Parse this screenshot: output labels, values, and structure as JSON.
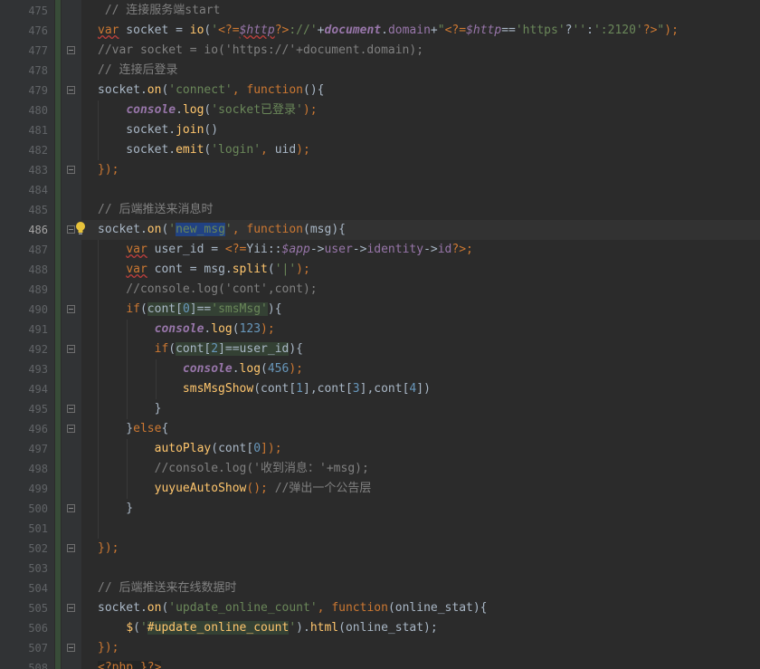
{
  "editor": {
    "current_line": "486",
    "lines": [
      {
        "n": "475",
        "segs": [
          {
            "t": " // 连接服务端start",
            "c": "cm"
          }
        ]
      },
      {
        "n": "476",
        "segs": [
          {
            "t": "var",
            "c": "kw wavy"
          },
          {
            "t": " socket = ",
            "c": ""
          },
          {
            "t": "io",
            "c": "fn"
          },
          {
            "t": "(",
            "c": ""
          },
          {
            "t": "'",
            "c": "str"
          },
          {
            "t": "<?=",
            "c": "php"
          },
          {
            "t": "$http",
            "c": "phpvar wavy"
          },
          {
            "t": "?>",
            "c": "php"
          },
          {
            "t": "://'",
            "c": "str"
          },
          {
            "t": "+",
            "c": ""
          },
          {
            "t": "document",
            "c": "glob"
          },
          {
            "t": ".",
            "c": ""
          },
          {
            "t": "domain",
            "c": "prop"
          },
          {
            "t": "+",
            "c": ""
          },
          {
            "t": "\"",
            "c": "str"
          },
          {
            "t": "<?=",
            "c": "php"
          },
          {
            "t": "$http",
            "c": "phpvar"
          },
          {
            "t": "==",
            "c": ""
          },
          {
            "t": "'https'",
            "c": "str"
          },
          {
            "t": "?",
            "c": ""
          },
          {
            "t": "''",
            "c": "str"
          },
          {
            "t": ":",
            "c": ""
          },
          {
            "t": "':2120'",
            "c": "str"
          },
          {
            "t": "?>",
            "c": "php"
          },
          {
            "t": "\"",
            "c": "str"
          },
          {
            "t": ");",
            "c": "punct"
          }
        ]
      },
      {
        "n": "477",
        "segs": [
          {
            "t": "//var socket = io('https://'+document.domain);",
            "c": "cm"
          }
        ]
      },
      {
        "n": "478",
        "segs": [
          {
            "t": "// 连接后登录",
            "c": "cm"
          }
        ]
      },
      {
        "n": "479",
        "segs": [
          {
            "t": "socket.",
            "c": ""
          },
          {
            "t": "on",
            "c": "fn"
          },
          {
            "t": "(",
            "c": ""
          },
          {
            "t": "'connect'",
            "c": "str"
          },
          {
            "t": ", ",
            "c": "punct"
          },
          {
            "t": "function",
            "c": "kw"
          },
          {
            "t": "(){",
            "c": ""
          }
        ]
      },
      {
        "n": "480",
        "segs": [
          {
            "t": "    ",
            "c": ""
          },
          {
            "t": "console",
            "c": "glob"
          },
          {
            "t": ".",
            "c": ""
          },
          {
            "t": "log",
            "c": "fn"
          },
          {
            "t": "(",
            "c": ""
          },
          {
            "t": "'socket已登录'",
            "c": "str"
          },
          {
            "t": ");",
            "c": "punct"
          }
        ]
      },
      {
        "n": "481",
        "segs": [
          {
            "t": "    socket.",
            "c": ""
          },
          {
            "t": "join",
            "c": "fn"
          },
          {
            "t": "()",
            "c": ""
          }
        ]
      },
      {
        "n": "482",
        "segs": [
          {
            "t": "    socket.",
            "c": ""
          },
          {
            "t": "emit",
            "c": "fn"
          },
          {
            "t": "(",
            "c": ""
          },
          {
            "t": "'login'",
            "c": "str"
          },
          {
            "t": ", ",
            "c": "punct"
          },
          {
            "t": "uid",
            "c": ""
          },
          {
            "t": ");",
            "c": "punct"
          }
        ]
      },
      {
        "n": "483",
        "segs": [
          {
            "t": "});",
            "c": "punct"
          }
        ]
      },
      {
        "n": "484",
        "segs": []
      },
      {
        "n": "485",
        "segs": [
          {
            "t": "// 后端推送来消息时",
            "c": "cm"
          }
        ]
      },
      {
        "n": "486",
        "segs": [
          {
            "t": "socket.",
            "c": ""
          },
          {
            "t": "on",
            "c": "fn"
          },
          {
            "t": "(",
            "c": ""
          },
          {
            "t": "'",
            "c": "str"
          },
          {
            "t": "new_msg",
            "c": "str sel"
          },
          {
            "t": "'",
            "c": "str"
          },
          {
            "t": ", ",
            "c": "punct"
          },
          {
            "t": "function",
            "c": "kw"
          },
          {
            "t": "(msg){",
            "c": ""
          }
        ]
      },
      {
        "n": "487",
        "segs": [
          {
            "t": "    ",
            "c": ""
          },
          {
            "t": "var",
            "c": "kw wavy"
          },
          {
            "t": " user_id = ",
            "c": ""
          },
          {
            "t": "<?=",
            "c": "php"
          },
          {
            "t": "Yii::",
            "c": ""
          },
          {
            "t": "$app",
            "c": "phpvar"
          },
          {
            "t": "->",
            "c": ""
          },
          {
            "t": "user",
            "c": "prop"
          },
          {
            "t": "->",
            "c": ""
          },
          {
            "t": "identity",
            "c": "prop"
          },
          {
            "t": "->",
            "c": ""
          },
          {
            "t": "id",
            "c": "prop"
          },
          {
            "t": "?>",
            "c": "php"
          },
          {
            "t": ";",
            "c": "punct"
          }
        ]
      },
      {
        "n": "488",
        "segs": [
          {
            "t": "    ",
            "c": ""
          },
          {
            "t": "var",
            "c": "kw wavy"
          },
          {
            "t": " cont = msg.",
            "c": ""
          },
          {
            "t": "split",
            "c": "fn"
          },
          {
            "t": "(",
            "c": ""
          },
          {
            "t": "'|'",
            "c": "str"
          },
          {
            "t": ");",
            "c": "punct"
          }
        ]
      },
      {
        "n": "489",
        "segs": [
          {
            "t": "    //console.log('cont',cont);",
            "c": "cm"
          }
        ]
      },
      {
        "n": "490",
        "segs": [
          {
            "t": "    ",
            "c": ""
          },
          {
            "t": "if",
            "c": "kw"
          },
          {
            "t": "(",
            "c": ""
          },
          {
            "t": "cont[",
            "c": "hl"
          },
          {
            "t": "0",
            "c": "num hl"
          },
          {
            "t": "]==",
            "c": "hl"
          },
          {
            "t": "'smsMsg'",
            "c": "str hl"
          },
          {
            "t": "){",
            "c": ""
          }
        ]
      },
      {
        "n": "491",
        "segs": [
          {
            "t": "        ",
            "c": ""
          },
          {
            "t": "console",
            "c": "glob"
          },
          {
            "t": ".",
            "c": ""
          },
          {
            "t": "log",
            "c": "fn"
          },
          {
            "t": "(",
            "c": ""
          },
          {
            "t": "123",
            "c": "num"
          },
          {
            "t": ");",
            "c": "punct"
          }
        ]
      },
      {
        "n": "492",
        "segs": [
          {
            "t": "        ",
            "c": ""
          },
          {
            "t": "if",
            "c": "kw"
          },
          {
            "t": "(",
            "c": ""
          },
          {
            "t": "cont[",
            "c": "hl"
          },
          {
            "t": "2",
            "c": "num hl"
          },
          {
            "t": "]==user_id",
            "c": "hl"
          },
          {
            "t": "){",
            "c": ""
          }
        ]
      },
      {
        "n": "493",
        "segs": [
          {
            "t": "            ",
            "c": ""
          },
          {
            "t": "console",
            "c": "glob"
          },
          {
            "t": ".",
            "c": ""
          },
          {
            "t": "log",
            "c": "fn"
          },
          {
            "t": "(",
            "c": ""
          },
          {
            "t": "456",
            "c": "num"
          },
          {
            "t": ");",
            "c": "punct"
          }
        ]
      },
      {
        "n": "494",
        "segs": [
          {
            "t": "            ",
            "c": ""
          },
          {
            "t": "smsMsgShow",
            "c": "fn"
          },
          {
            "t": "(cont[",
            "c": ""
          },
          {
            "t": "1",
            "c": "num"
          },
          {
            "t": "],cont[",
            "c": ""
          },
          {
            "t": "3",
            "c": "num"
          },
          {
            "t": "],cont[",
            "c": ""
          },
          {
            "t": "4",
            "c": "num"
          },
          {
            "t": "])",
            "c": ""
          }
        ]
      },
      {
        "n": "495",
        "segs": [
          {
            "t": "        }",
            "c": ""
          }
        ]
      },
      {
        "n": "496",
        "segs": [
          {
            "t": "    }",
            "c": ""
          },
          {
            "t": "else",
            "c": "kw"
          },
          {
            "t": "{",
            "c": ""
          }
        ]
      },
      {
        "n": "497",
        "segs": [
          {
            "t": "        ",
            "c": ""
          },
          {
            "t": "autoPlay",
            "c": "fn"
          },
          {
            "t": "(cont[",
            "c": ""
          },
          {
            "t": "0",
            "c": "num"
          },
          {
            "t": "]);",
            "c": "punct"
          }
        ]
      },
      {
        "n": "498",
        "segs": [
          {
            "t": "        //console.log('收到消息：'+msg);",
            "c": "cm"
          }
        ]
      },
      {
        "n": "499",
        "segs": [
          {
            "t": "        ",
            "c": ""
          },
          {
            "t": "yuyueAutoShow",
            "c": "fn"
          },
          {
            "t": "(); ",
            "c": "punct"
          },
          {
            "t": "//弹出一个公告层",
            "c": "cm"
          }
        ]
      },
      {
        "n": "500",
        "segs": [
          {
            "t": "    }",
            "c": ""
          }
        ]
      },
      {
        "n": "501",
        "segs": []
      },
      {
        "n": "502",
        "segs": [
          {
            "t": "});",
            "c": "punct"
          }
        ]
      },
      {
        "n": "503",
        "segs": []
      },
      {
        "n": "504",
        "segs": [
          {
            "t": "// 后端推送来在线数据时",
            "c": "cm"
          }
        ]
      },
      {
        "n": "505",
        "segs": [
          {
            "t": "socket.",
            "c": ""
          },
          {
            "t": "on",
            "c": "fn"
          },
          {
            "t": "(",
            "c": ""
          },
          {
            "t": "'update_online_count'",
            "c": "str"
          },
          {
            "t": ", ",
            "c": "punct"
          },
          {
            "t": "function",
            "c": "kw"
          },
          {
            "t": "(online_stat){",
            "c": ""
          }
        ]
      },
      {
        "n": "506",
        "segs": [
          {
            "t": "    ",
            "c": ""
          },
          {
            "t": "$",
            "c": "fn"
          },
          {
            "t": "(",
            "c": ""
          },
          {
            "t": "'",
            "c": "str"
          },
          {
            "t": "#update_online_count",
            "c": "fn hl"
          },
          {
            "t": "'",
            "c": "str"
          },
          {
            "t": ").",
            "c": ""
          },
          {
            "t": "html",
            "c": "fn"
          },
          {
            "t": "(online_stat);",
            "c": ""
          }
        ]
      },
      {
        "n": "507",
        "segs": [
          {
            "t": "});",
            "c": "punct"
          }
        ]
      },
      {
        "n": "508",
        "segs": [
          {
            "t": "<?php }?>",
            "c": "php phpbg"
          }
        ]
      }
    ]
  },
  "icons": {
    "fold": "fold-marker-icon",
    "bulb": "lightbulb-icon"
  },
  "colors": {
    "background": "#2b2b2b",
    "gutter": "#313335",
    "keyword": "#cc7832",
    "string": "#6a8759",
    "comment": "#808080",
    "function": "#ffc66d",
    "number": "#6897bb",
    "global": "#9876aa"
  }
}
